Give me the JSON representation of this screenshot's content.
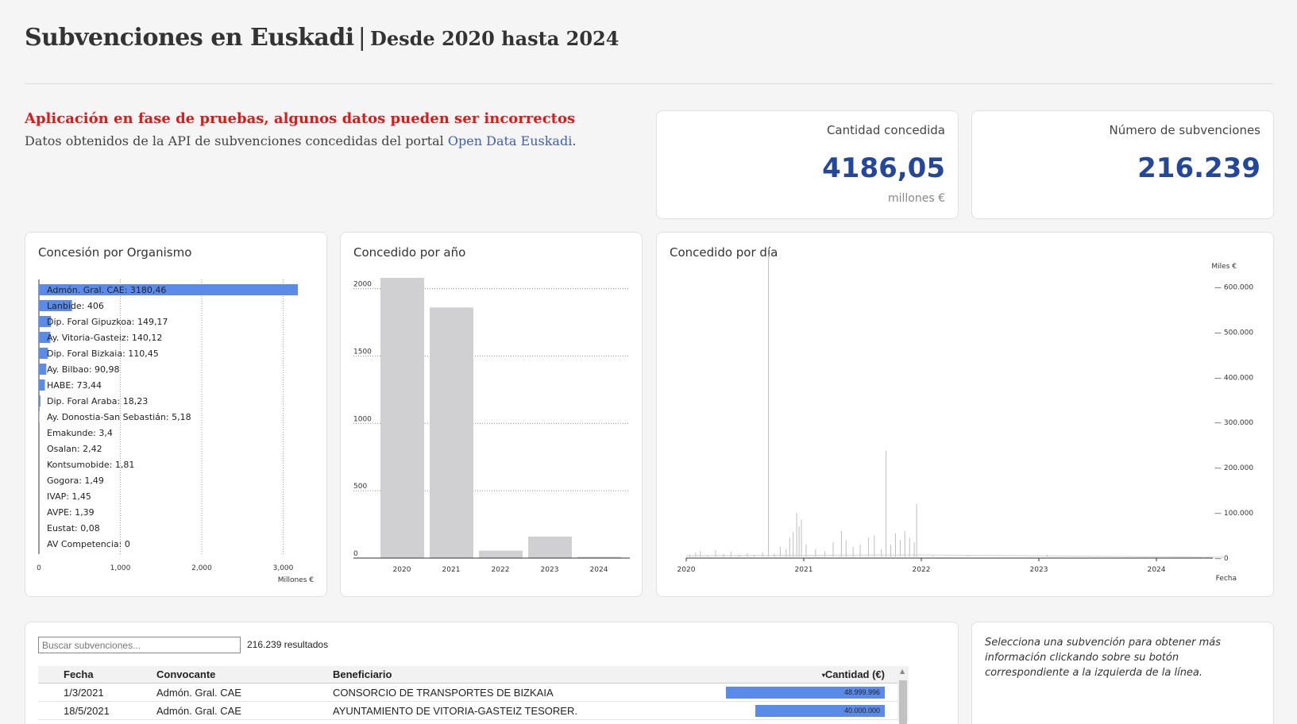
{
  "header": {
    "title": "Subvenciones en Euskadi",
    "separator": "|",
    "subtitle": "Desde 2020 hasta 2024"
  },
  "warning": "Aplicación en fase de pruebas, algunos datos pueden ser incorrectos",
  "info": {
    "text": "Datos obtenidos de la API de subvenciones concedidas del portal ",
    "link": "Open Data Euskadi",
    "suffix": "."
  },
  "kpis": {
    "amount": {
      "label": "Cantidad concedida",
      "value": "4186,05",
      "unit": "millones €"
    },
    "count": {
      "label": "Número de subvenciones",
      "value": "216.239"
    }
  },
  "colors": {
    "accent": "#23479d",
    "bar_blue": "#5b8be8",
    "bar_grey": "#d0d0d2",
    "warning": "#e01818"
  },
  "chart_data": [
    {
      "type": "bar",
      "orientation": "horizontal",
      "title": "Concesión por Organismo",
      "xlabel": "Millones €",
      "xlim": [
        0,
        3180.46
      ],
      "xticks": [
        "0",
        "1,000",
        "2,000",
        "3,000"
      ],
      "series": [
        {
          "categories": [
            "Admón. Gral. CAE",
            "Lanbide",
            "Dip. Foral Gipuzkoa",
            "Ay. Vitoria-Gasteiz",
            "Dip. Foral Bizkaia",
            "Ay. Bilbao",
            "HABE",
            "Dip. Foral Araba",
            "Ay. Donostia-San Sebastián",
            "Emakunde",
            "Osalan",
            "Kontsumobide",
            "Gogora",
            "IVAP",
            "AVPE",
            "Eustat",
            "AV Competencia"
          ],
          "values": [
            3180.46,
            406,
            149.17,
            140.12,
            110.45,
            90.98,
            73.44,
            18.23,
            5.18,
            3.4,
            2.42,
            1.81,
            1.49,
            1.45,
            1.39,
            0.08,
            0
          ],
          "labels": [
            "Admón. Gral. CAE: 3180,46",
            "Lanbide: 406",
            "Dip. Foral Gipuzkoa: 149,17",
            "Ay. Vitoria-Gasteiz: 140,12",
            "Dip. Foral Bizkaia: 110,45",
            "Ay. Bilbao: 90,98",
            "HABE: 73,44",
            "Dip. Foral Araba: 18,23",
            "Ay. Donostia-San Sebastián: 5,18",
            "Emakunde: 3,4",
            "Osalan: 2,42",
            "Kontsumobide: 1,81",
            "Gogora: 1,49",
            "IVAP: 1,45",
            "AVPE: 1,39",
            "Eustat: 0,08",
            "AV Competencia: 0"
          ]
        }
      ],
      "grid": true
    },
    {
      "type": "bar",
      "title": "Concedido por año",
      "categories": [
        "2020",
        "2021",
        "2022",
        "2023",
        "2024"
      ],
      "values": [
        2080,
        1860,
        55,
        160,
        10
      ],
      "ylim": [
        0,
        2080
      ],
      "yticks": [
        "0",
        "500",
        "1000",
        "1500",
        "2000"
      ],
      "grid": true
    },
    {
      "type": "line",
      "title": "Concedido por día",
      "ylabel": "Miles €",
      "xlabel": "Fecha",
      "xticks": [
        "2020",
        "2021",
        "2022",
        "2023",
        "2024"
      ],
      "yticks": [
        "0",
        "100.000",
        "200.000",
        "300.000",
        "400.000",
        "500.000",
        "600.000"
      ],
      "ylim": [
        0,
        650000
      ],
      "spikes": [
        {
          "x": 2020.03,
          "y": 8000
        },
        {
          "x": 2020.08,
          "y": 12000
        },
        {
          "x": 2020.12,
          "y": 15000
        },
        {
          "x": 2020.18,
          "y": 6000
        },
        {
          "x": 2020.25,
          "y": 18000
        },
        {
          "x": 2020.32,
          "y": 9000
        },
        {
          "x": 2020.38,
          "y": 14000
        },
        {
          "x": 2020.45,
          "y": 7000
        },
        {
          "x": 2020.52,
          "y": 11000
        },
        {
          "x": 2020.58,
          "y": 8000
        },
        {
          "x": 2020.65,
          "y": 13000
        },
        {
          "x": 2020.7,
          "y": 672000
        },
        {
          "x": 2020.75,
          "y": 10000
        },
        {
          "x": 2020.8,
          "y": 25000
        },
        {
          "x": 2020.85,
          "y": 20000
        },
        {
          "x": 2020.88,
          "y": 45000
        },
        {
          "x": 2020.91,
          "y": 58000
        },
        {
          "x": 2020.94,
          "y": 100000
        },
        {
          "x": 2020.96,
          "y": 70000
        },
        {
          "x": 2020.98,
          "y": 85000
        },
        {
          "x": 2021.02,
          "y": 30000
        },
        {
          "x": 2021.1,
          "y": 20000
        },
        {
          "x": 2021.18,
          "y": 15000
        },
        {
          "x": 2021.25,
          "y": 35000
        },
        {
          "x": 2021.32,
          "y": 60000
        },
        {
          "x": 2021.36,
          "y": 40000
        },
        {
          "x": 2021.42,
          "y": 25000
        },
        {
          "x": 2021.48,
          "y": 30000
        },
        {
          "x": 2021.55,
          "y": 45000
        },
        {
          "x": 2021.6,
          "y": 50000
        },
        {
          "x": 2021.66,
          "y": 20000
        },
        {
          "x": 2021.7,
          "y": 238000
        },
        {
          "x": 2021.74,
          "y": 30000
        },
        {
          "x": 2021.78,
          "y": 55000
        },
        {
          "x": 2021.82,
          "y": 40000
        },
        {
          "x": 2021.86,
          "y": 60000
        },
        {
          "x": 2021.9,
          "y": 45000
        },
        {
          "x": 2021.94,
          "y": 35000
        },
        {
          "x": 2021.96,
          "y": 120000
        },
        {
          "x": 2022.1,
          "y": 5000
        },
        {
          "x": 2022.4,
          "y": 4000
        },
        {
          "x": 2022.7,
          "y": 3000
        },
        {
          "x": 2023.07,
          "y": 7000
        },
        {
          "x": 2023.5,
          "y": 3000
        },
        {
          "x": 2024.1,
          "y": 3000
        },
        {
          "x": 2024.4,
          "y": 2000
        }
      ]
    }
  ],
  "table": {
    "search_placeholder": "Buscar subvenciones...",
    "results": "216.239 resultados",
    "headers": [
      "Fecha",
      "Convocante",
      "Beneficiario",
      "Cantidad (€)"
    ],
    "rows": [
      {
        "fecha": "1/3/2021",
        "convocante": "Admón. Gral. CAE",
        "beneficiario": "CONSORCIO DE TRANSPORTES DE BIZKAIA",
        "cantidad": "48.999.996",
        "value": 48999996
      },
      {
        "fecha": "18/5/2021",
        "convocante": "Admón. Gral. CAE",
        "beneficiario": "AYUNTAMIENTO DE VITORIA-GASTEIZ TESORER.",
        "cantidad": "40.000.000",
        "value": 40000000
      }
    ]
  },
  "side_note": "Selecciona una subvención para obtener más información clickando sobre su botón correspondiente a la izquierda de la línea."
}
